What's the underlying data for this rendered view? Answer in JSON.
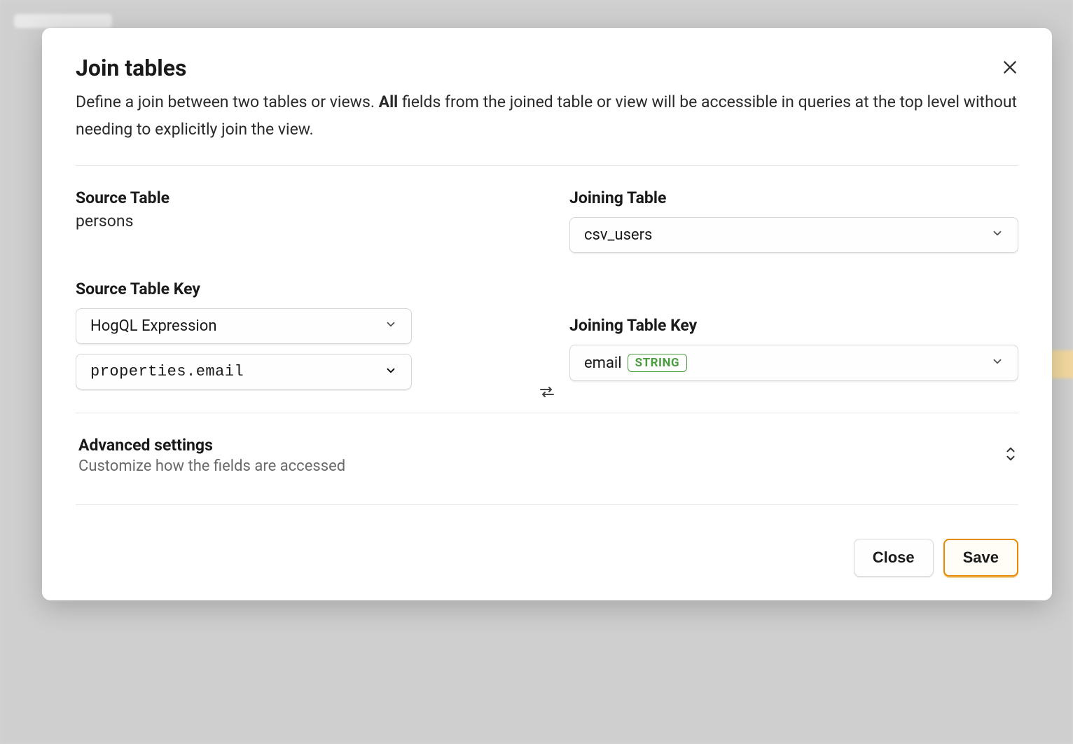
{
  "modal": {
    "title": "Join tables",
    "subtitle_pre": "Define a join between two tables or views. ",
    "subtitle_bold": "All",
    "subtitle_post": " fields from the joined table or view will be accessible in queries at the top level without needing to explicitly join the view."
  },
  "source": {
    "table_label": "Source Table",
    "table_value": "persons",
    "key_label": "Source Table Key",
    "key_type_select": "HogQL Expression",
    "key_expression": "properties.email"
  },
  "joining": {
    "table_label": "Joining Table",
    "table_select": "csv_users",
    "key_label": "Joining Table Key",
    "key_select_field": "email",
    "key_select_type_badge": "STRING"
  },
  "advanced": {
    "title": "Advanced settings",
    "subtitle": "Customize how the fields are accessed"
  },
  "footer": {
    "close": "Close",
    "save": "Save"
  }
}
